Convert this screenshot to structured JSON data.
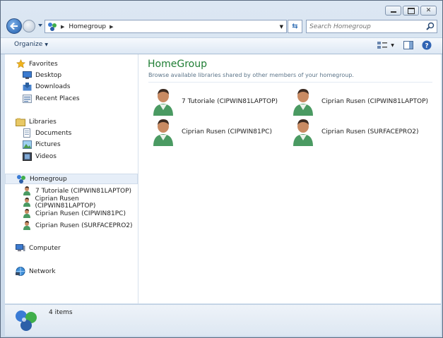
{
  "addressbar": {
    "crumb": "Homegroup",
    "search_placeholder": "Search Homegroup"
  },
  "toolbar": {
    "organize_label": "Organize"
  },
  "sidebar": {
    "favorites": {
      "label": "Favorites",
      "items": [
        {
          "label": "Desktop"
        },
        {
          "label": "Downloads"
        },
        {
          "label": "Recent Places"
        }
      ]
    },
    "libraries": {
      "label": "Libraries",
      "items": [
        {
          "label": "Documents"
        },
        {
          "label": "Pictures"
        },
        {
          "label": "Videos"
        }
      ]
    },
    "homegroup": {
      "label": "Homegroup",
      "items": [
        {
          "label": "7 Tutoriale (CIPWIN81LAPTOP)"
        },
        {
          "label": "Ciprian Rusen (CIPWIN81LAPTOP)"
        },
        {
          "label": "Ciprian Rusen (CIPWIN81PC)"
        },
        {
          "label": "Ciprian Rusen (SURFACEPRO2)"
        }
      ]
    },
    "computer": {
      "label": "Computer"
    },
    "network": {
      "label": "Network"
    }
  },
  "main": {
    "title": "HomeGroup",
    "subtitle": "Browse available libraries shared by other members of your homegroup.",
    "members": [
      {
        "label": "7 Tutoriale (CIPWIN81LAPTOP)"
      },
      {
        "label": "Ciprian Rusen (CIPWIN81LAPTOP)"
      },
      {
        "label": "Ciprian Rusen (CIPWIN81PC)"
      },
      {
        "label": "Ciprian Rusen (SURFACEPRO2)"
      }
    ]
  },
  "status": {
    "count": "4 items"
  },
  "colors": {
    "title_green": "#1e7d33",
    "selection": "#e6eef8"
  }
}
